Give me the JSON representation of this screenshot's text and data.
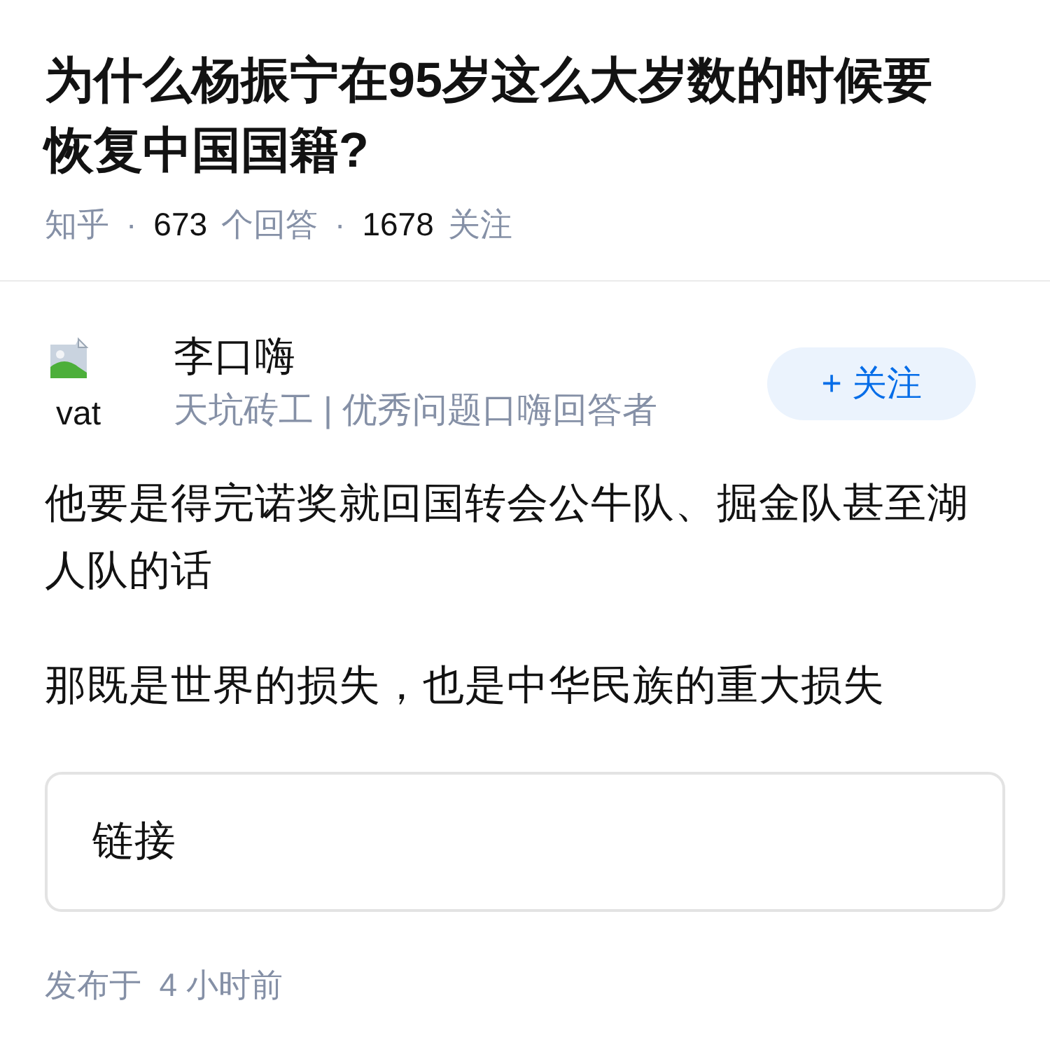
{
  "question": {
    "title": "为什么杨振宁在95岁这么大岁数的时候要恢复中国国籍?",
    "meta": [
      {
        "kind": "label",
        "text": "知乎"
      },
      {
        "kind": "separator",
        "text": "·"
      },
      {
        "kind": "count",
        "text": "673"
      },
      {
        "kind": "label",
        "text": "个回答"
      },
      {
        "kind": "separator",
        "text": "·"
      },
      {
        "kind": "count",
        "text": "1678"
      },
      {
        "kind": "label",
        "text": "关注"
      }
    ]
  },
  "answer": {
    "author": {
      "avatar_alt_text": "vat",
      "name": "李口嗨",
      "headline": "天坑砖工 | 优秀问题口嗨回答者"
    },
    "follow_button": {
      "label": "+ 关注"
    },
    "paragraphs": [
      "他要是得完诺奖就回国转会公牛队、掘金队甚至湖人队的话",
      "那既是世界的损失，也是中华民族的重大损失"
    ],
    "link_card": {
      "label": "链接"
    },
    "published": "发布于  4 小时前"
  }
}
